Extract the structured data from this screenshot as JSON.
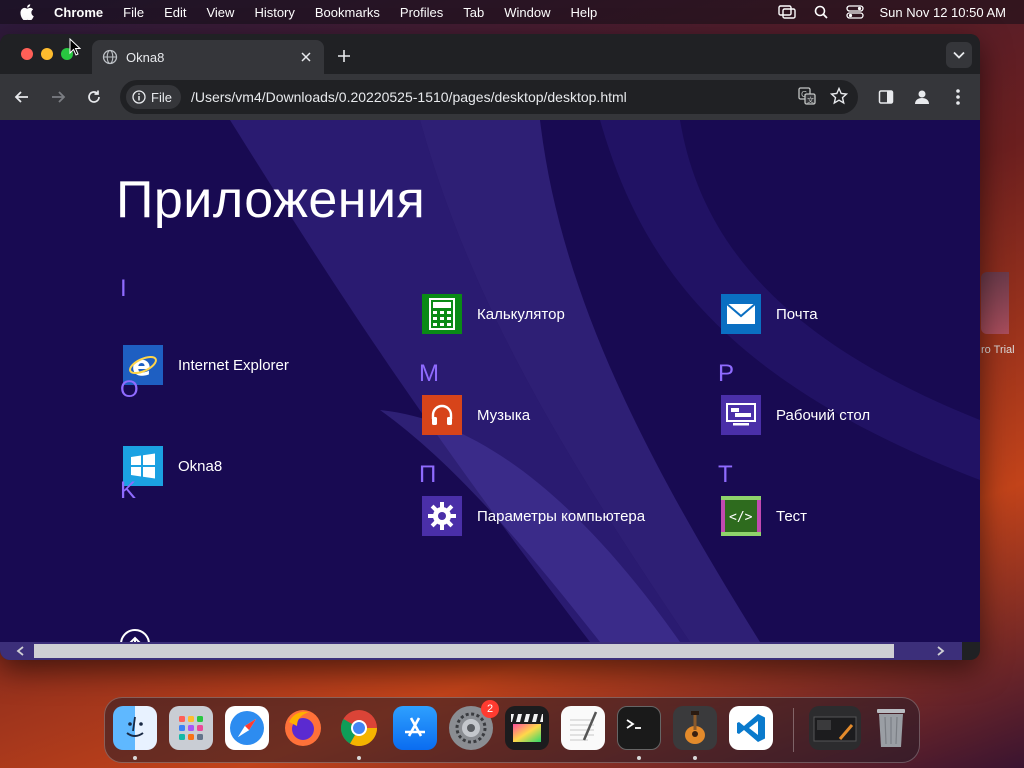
{
  "menubar": {
    "app_name": "Chrome",
    "items": [
      "File",
      "Edit",
      "View",
      "History",
      "Bookmarks",
      "Profiles",
      "Tab",
      "Window",
      "Help"
    ],
    "clock": "Sun Nov 12  10:50 AM"
  },
  "browser": {
    "tab_title": "Okna8",
    "omnibox_chip": "File",
    "url": "/Users/vm4/Downloads/0.20220525-1510/pages/desktop/desktop.html"
  },
  "page": {
    "title": "Приложения",
    "groups": [
      {
        "letter": "I",
        "apps": [
          {
            "label": "Internet Explorer",
            "icon": "internet-explorer-icon",
            "color": "#1e5fc2"
          }
        ]
      },
      {
        "letter": "O",
        "apps": [
          {
            "label": "Okna8",
            "icon": "windows-logo-icon",
            "color": "#1ba1e2"
          }
        ]
      },
      {
        "letter": "K",
        "apps": [
          {
            "label": "Калькулятор",
            "icon": "calculator-icon",
            "color": "#0a8a16"
          }
        ]
      },
      {
        "letter": "М",
        "apps": [
          {
            "label": "Музыка",
            "icon": "headphones-icon",
            "color": "#d7441a"
          }
        ]
      },
      {
        "letter": "П",
        "apps": [
          {
            "label": "Параметры компьютера",
            "icon": "gear-icon",
            "color": "#4a2fa8"
          }
        ]
      },
      {
        "letter": "",
        "apps": [
          {
            "label": "Почта",
            "icon": "mail-icon",
            "color": "#0a6fc2"
          }
        ]
      },
      {
        "letter": "Р",
        "apps": [
          {
            "label": "Рабочий стол",
            "icon": "desktop-icon",
            "color": "#4a2fa8"
          }
        ]
      },
      {
        "letter": "Т",
        "apps": [
          {
            "label": "Тест",
            "icon": "code-test-icon",
            "color": "#c24ab0"
          }
        ]
      }
    ]
  },
  "desktop_peek_label": "ro Trial",
  "dock": {
    "items": [
      "finder-icon",
      "launchpad-icon",
      "safari-icon",
      "firefox-icon",
      "chrome-icon",
      "app-store-icon",
      "system-settings-icon",
      "final-cut-icon",
      "textedit-icon",
      "terminal-icon",
      "garageband-icon",
      "vscode-icon",
      "screenshot-thumb-icon",
      "trash-icon"
    ],
    "settings_badge": "2"
  },
  "colors": {
    "page_bg": "#180a52",
    "letter": "#8f6bff",
    "chrome_dark": "#202124",
    "chrome_toolbar": "#35363a"
  }
}
